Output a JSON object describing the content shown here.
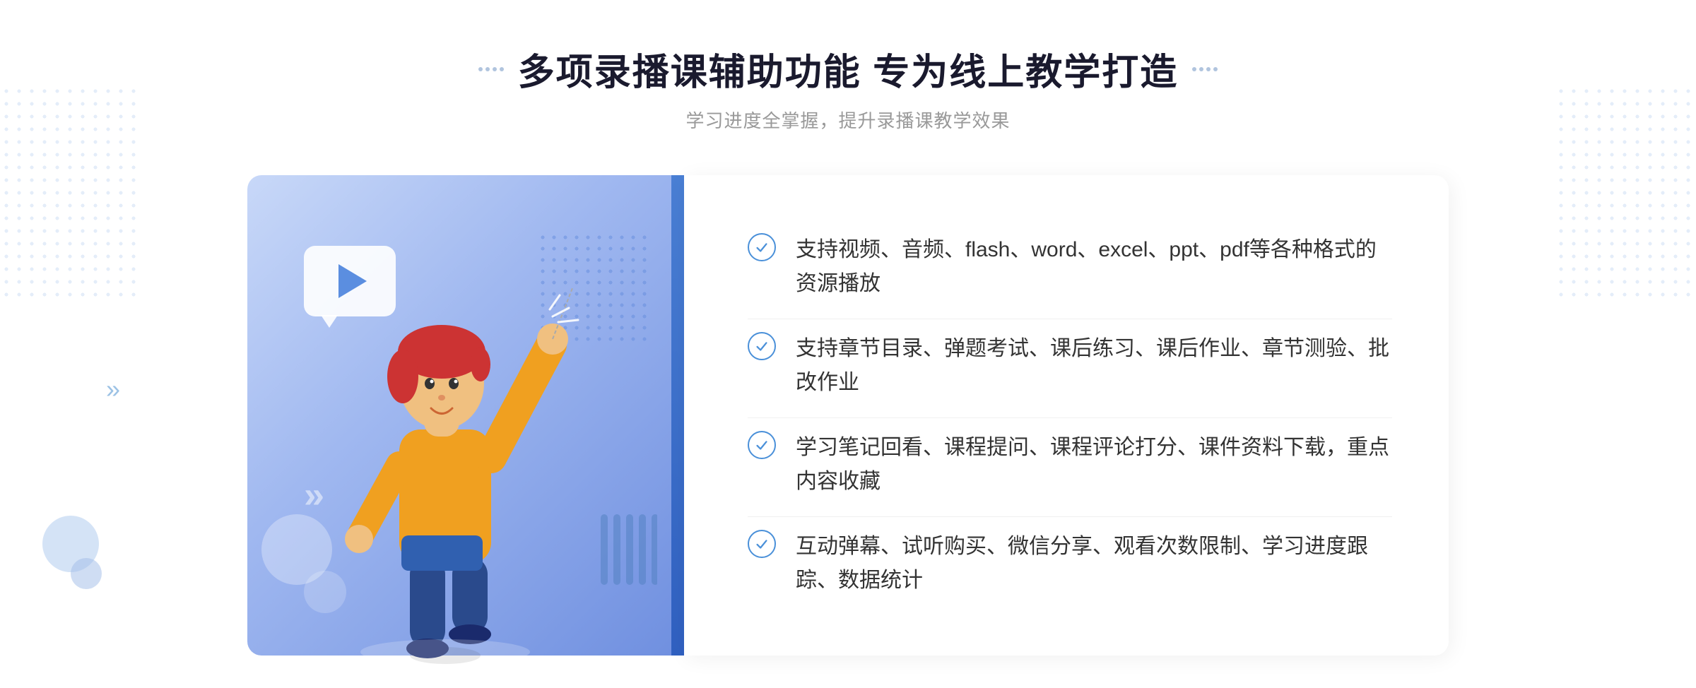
{
  "header": {
    "title": "多项录播课辅助功能 专为线上教学打造",
    "subtitle": "学习进度全掌握，提升录播课教学效果",
    "decorator_left": "⁞⁞",
    "decorator_right": "⁞⁞"
  },
  "features": [
    {
      "id": 1,
      "text": "支持视频、音频、flash、word、excel、ppt、pdf等各种格式的资源播放"
    },
    {
      "id": 2,
      "text": "支持章节目录、弹题考试、课后练习、课后作业、章节测验、批改作业"
    },
    {
      "id": 3,
      "text": "学习笔记回看、课程提问、课程评论打分、课件资料下载，重点内容收藏"
    },
    {
      "id": 4,
      "text": "互动弹幕、试听购买、微信分享、观看次数限制、学习进度跟踪、数据统计"
    }
  ],
  "arrows": {
    "left": "»"
  }
}
